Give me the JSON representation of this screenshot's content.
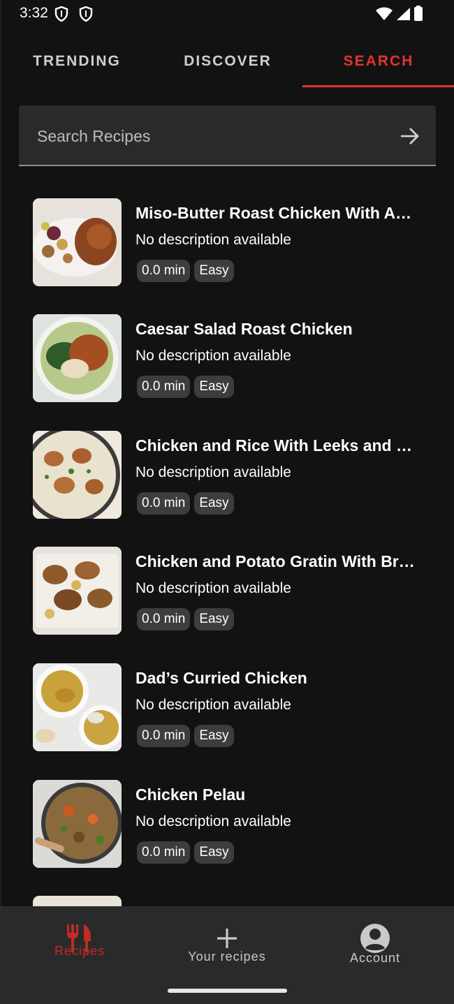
{
  "status": {
    "time": "3:32"
  },
  "tabs": [
    {
      "label": "TRENDING"
    },
    {
      "label": "DISCOVER"
    },
    {
      "label": "SEARCH"
    }
  ],
  "search": {
    "placeholder": "Search Recipes"
  },
  "recipes": [
    {
      "title": "Miso-Butter Roast Chicken With A…",
      "description": "No description available",
      "time": "0.0 min",
      "difficulty": "Easy"
    },
    {
      "title": "Caesar Salad Roast Chicken",
      "description": "No description available",
      "time": "0.0 min",
      "difficulty": "Easy"
    },
    {
      "title": "Chicken and Rice With Leeks and …",
      "description": "No description available",
      "time": "0.0 min",
      "difficulty": "Easy"
    },
    {
      "title": "Chicken and Potato Gratin With Br…",
      "description": "No description available",
      "time": "0.0 min",
      "difficulty": "Easy"
    },
    {
      "title": "Dad’s Curried Chicken",
      "description": "No description available",
      "time": "0.0 min",
      "difficulty": "Easy"
    },
    {
      "title": "Chicken Pelau",
      "description": "No description available",
      "time": "0.0 min",
      "difficulty": "Easy"
    }
  ],
  "bottom_nav": [
    {
      "label": "Recipes",
      "icon": "fork-knife-icon"
    },
    {
      "label": "Your recipes",
      "icon": "plus-icon"
    },
    {
      "label": "Account",
      "icon": "account-circle-icon"
    }
  ],
  "colors": {
    "accent": "#e0342f",
    "background": "#121212",
    "surface": "#2a2a2a"
  }
}
